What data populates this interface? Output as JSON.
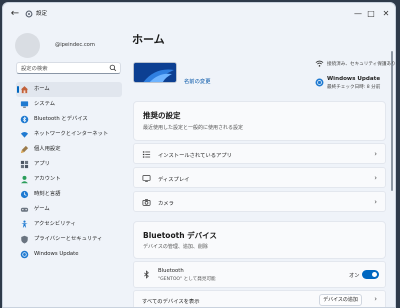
{
  "window": {
    "title": "設定"
  },
  "user": {
    "email": "@ipeindec.com"
  },
  "search": {
    "placeholder": "設定の検索"
  },
  "sidebar": {
    "items": [
      {
        "label": "ホーム",
        "icon": "home-icon",
        "color": "#c2613a"
      },
      {
        "label": "システム",
        "icon": "system-icon",
        "color": "#1f7ad1"
      },
      {
        "label": "Bluetooth とデバイス",
        "icon": "bluetooth-icon",
        "color": "#1f7ad1"
      },
      {
        "label": "ネットワークとインターネット",
        "icon": "network-icon",
        "color": "#1f7ad1"
      },
      {
        "label": "個人用設定",
        "icon": "personalization-icon",
        "color": "#9a7a4a"
      },
      {
        "label": "アプリ",
        "icon": "apps-icon",
        "color": "#4a5462"
      },
      {
        "label": "アカウント",
        "icon": "accounts-icon",
        "color": "#2a9d5b"
      },
      {
        "label": "時刻と言語",
        "icon": "time-language-icon",
        "color": "#1f7ad1"
      },
      {
        "label": "ゲーム",
        "icon": "gaming-icon",
        "color": "#6a7480"
      },
      {
        "label": "アクセシビリティ",
        "icon": "accessibility-icon",
        "color": "#1f7ad1"
      },
      {
        "label": "プライバシーとセキュリティ",
        "icon": "privacy-shield-icon",
        "color": "#6a7480"
      },
      {
        "label": "Windows Update",
        "icon": "windows-update-icon",
        "color": "#1f7ad1"
      }
    ]
  },
  "main": {
    "title": "ホーム",
    "rename_link": "名前の変更",
    "network_status": "接続済み、セキュリティ保護あり",
    "update": {
      "title": "Windows Update",
      "subtitle": "最終チェック日時: 8 分前"
    },
    "recommended": {
      "title": "推奨の設定",
      "subtitle": "最近使用した設定と一般的に使用される設定",
      "rows": [
        {
          "label": "インストールされているアプリ",
          "icon": "installed-apps-icon"
        },
        {
          "label": "ディスプレイ",
          "icon": "display-icon"
        },
        {
          "label": "カメラ",
          "icon": "camera-icon"
        }
      ]
    },
    "bluetooth": {
      "title": "Bluetooth デバイス",
      "subtitle": "デバイスの管理、追加、削除",
      "device_name": "Bluetooth",
      "device_desc": "\"GENTOO\" として発見可能",
      "toggle_label": "オン",
      "toggle_on": true,
      "view_all": "すべてのデバイスを表示",
      "add_button": "デバイスの追加"
    }
  },
  "colors": {
    "accent": "#0067c0",
    "window_bg": "#eff3f9",
    "card_bg": "#f9fafc"
  }
}
